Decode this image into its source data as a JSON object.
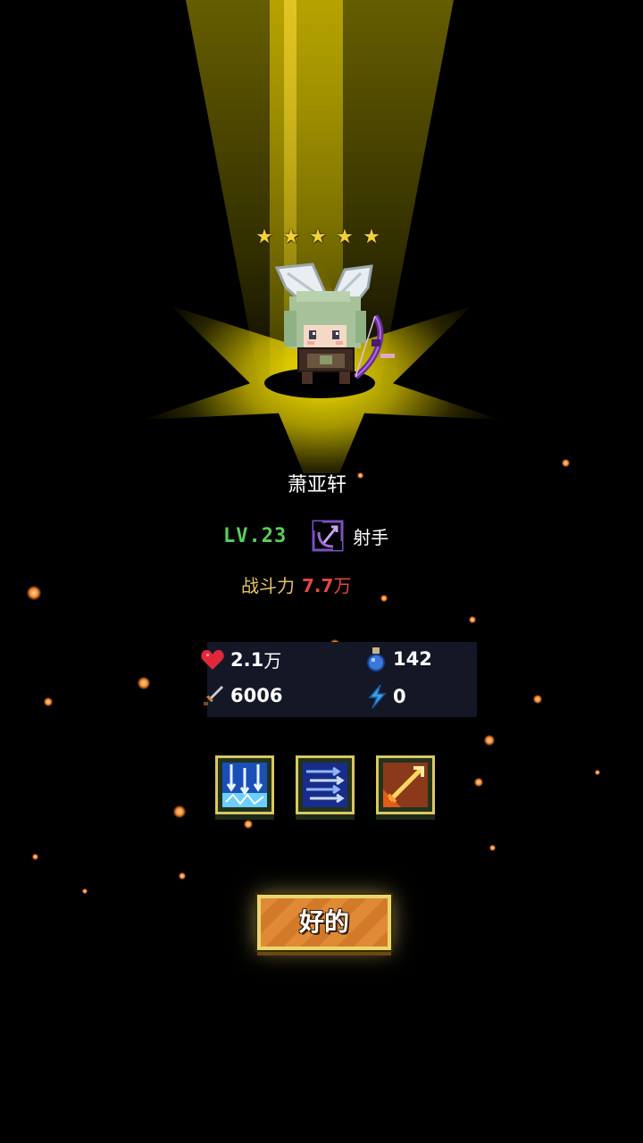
{
  "hero": {
    "stars": 5,
    "name": "萧亚轩",
    "level": "LV.23",
    "class_name": "射手",
    "class_icon": "bow-class-icon"
  },
  "power": {
    "label": "战斗力",
    "value": "7.7",
    "unit": "万"
  },
  "stats": {
    "hp": {
      "icon": "heart-icon",
      "value": "2.1",
      "unit": "万"
    },
    "mana": {
      "icon": "potion-icon",
      "value": "142"
    },
    "attack": {
      "icon": "sword-icon",
      "value": "6006"
    },
    "energy": {
      "icon": "lightning-icon",
      "value": "0"
    }
  },
  "skills": [
    {
      "icon": "ice-arrow-rain-skill-icon"
    },
    {
      "icon": "arrow-barrage-skill-icon"
    },
    {
      "icon": "fire-arrow-skill-icon"
    }
  ],
  "confirm_button": {
    "label": "好的"
  },
  "colors": {
    "level": "#58d05a",
    "power_label": "#e6c45a",
    "power_value": "#e04a3c",
    "spotlight": "#f0d800",
    "button": "#e08a36"
  }
}
